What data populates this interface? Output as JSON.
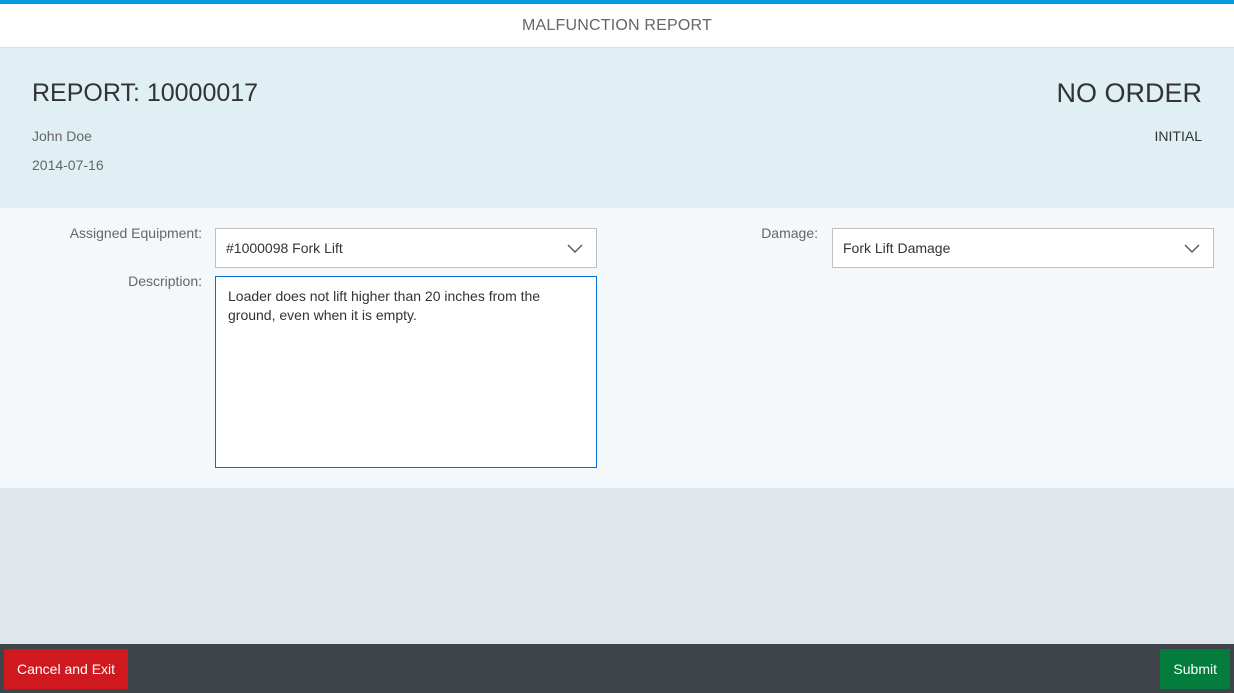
{
  "header": {
    "title": "MALFUNCTION REPORT"
  },
  "report": {
    "id_label": "REPORT: 10000017",
    "owner": "John Doe",
    "date": "2014-07-16",
    "order_status": "NO ORDER",
    "state": "INITIAL"
  },
  "form": {
    "equipment": {
      "label": "Assigned Equipment:",
      "value": "#1000098 Fork Lift"
    },
    "damage": {
      "label": "Damage:",
      "value": "Fork Lift Damage"
    },
    "description": {
      "label": "Description:",
      "value": "Loader does not lift higher than 20 inches from the ground, even when it is empty."
    }
  },
  "footer": {
    "cancel_label": "Cancel and Exit",
    "submit_label": "Submit"
  },
  "icons": {
    "dropdown": "chevron-down-icon"
  },
  "colors": {
    "accent": "#009de0",
    "header_bg": "#dfeff4",
    "cancel": "#d0191e",
    "submit": "#047c3c",
    "footer_bg": "#3f444b",
    "focus_border": "#0a6ed1"
  }
}
